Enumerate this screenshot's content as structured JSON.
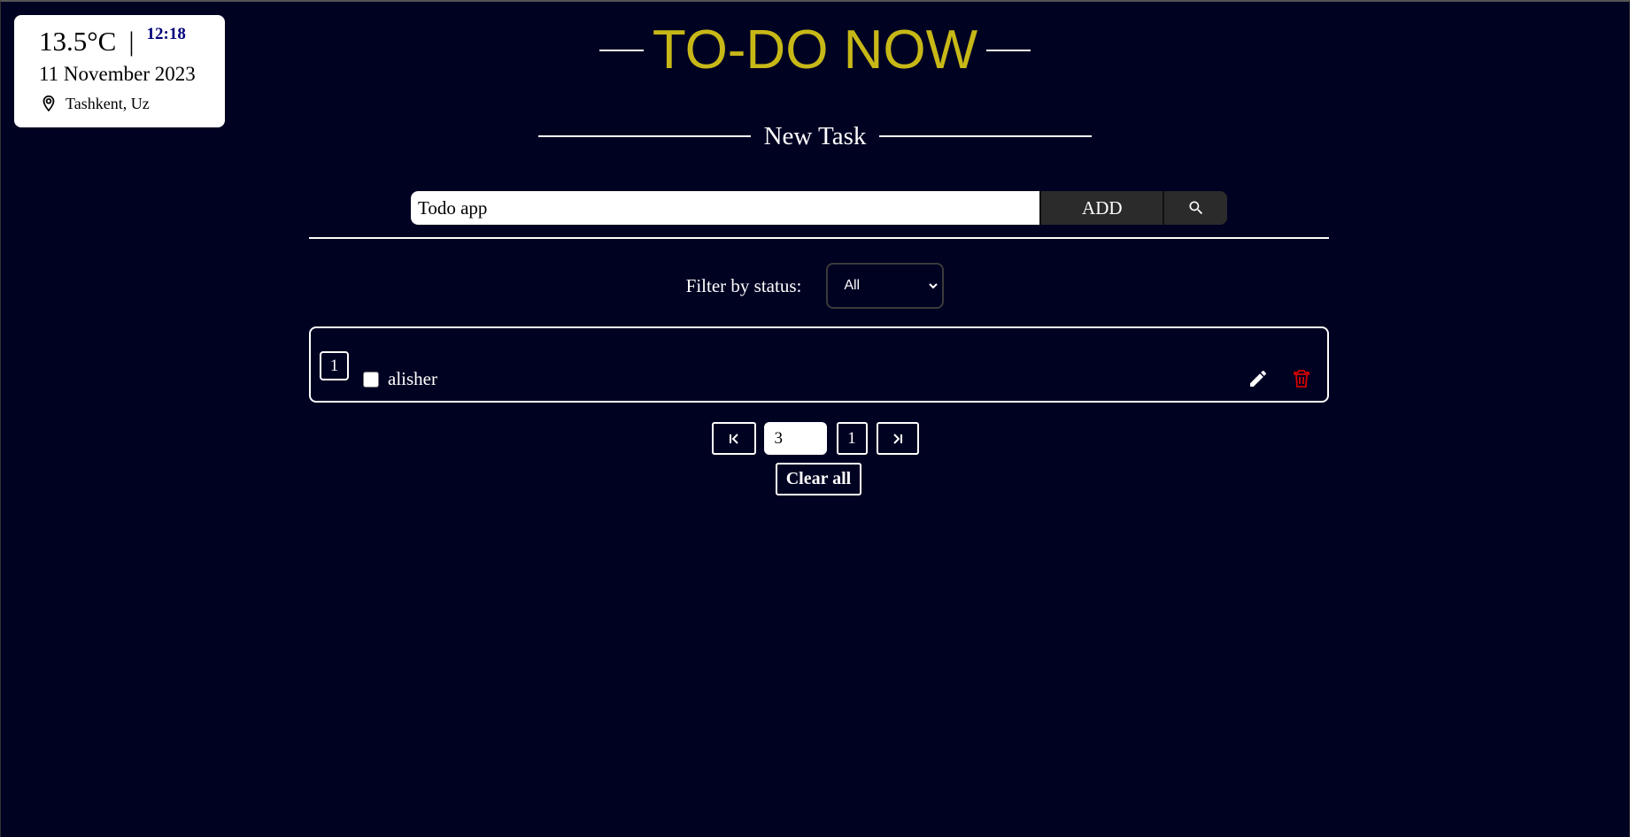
{
  "weather": {
    "temperature": "13.5°C",
    "separator": "|",
    "time": "12:18",
    "date": "11 November 2023",
    "location": "Tashkent, Uz",
    "icon": "location-pin-icon"
  },
  "header": {
    "title": "TO-DO NOW",
    "subtitle": "New Task",
    "title_color": "#c7b817"
  },
  "task_form": {
    "input_value": "Todo app",
    "add_label": "ADD",
    "search_icon": "search-icon"
  },
  "filter": {
    "label": "Filter by status:",
    "selected": "All"
  },
  "tasks": [
    {
      "number": "1",
      "name": "alisher",
      "completed": false
    }
  ],
  "pagination": {
    "per_page_value": "3",
    "current_page": "1"
  },
  "actions": {
    "clear_all_label": "Clear all"
  },
  "colors": {
    "background": "#000222",
    "delete": "#d40000"
  }
}
